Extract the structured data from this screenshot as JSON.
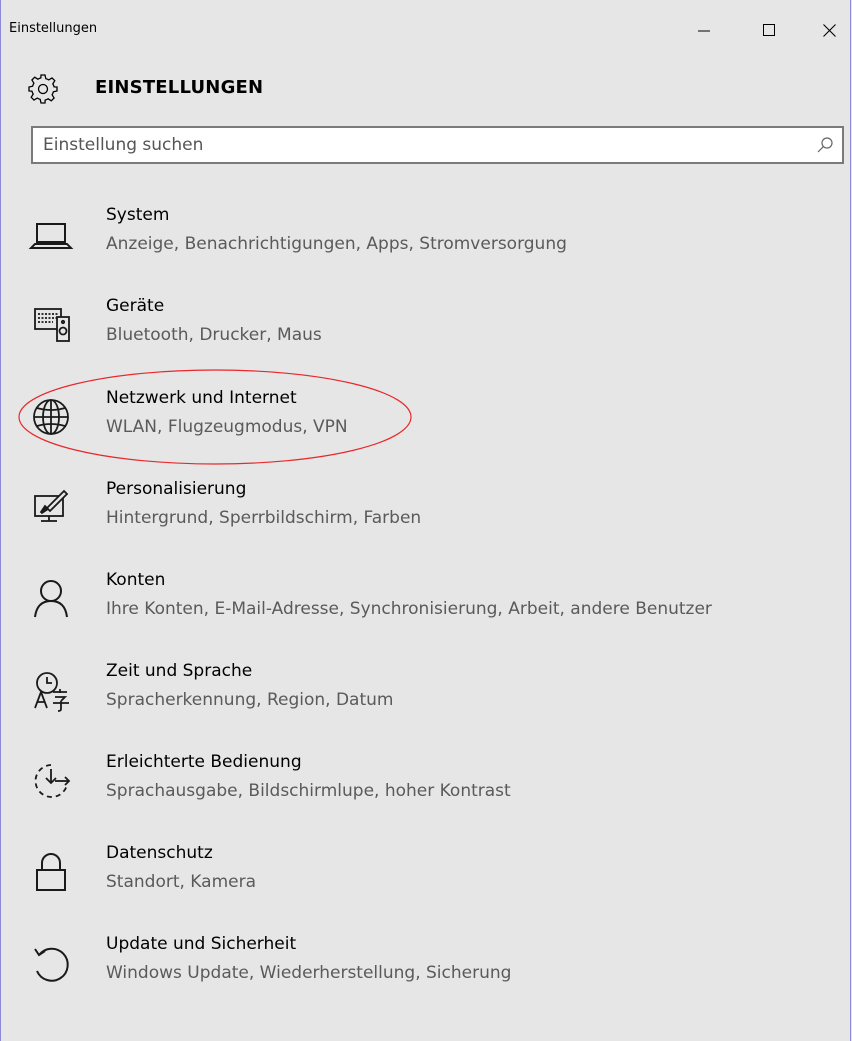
{
  "window": {
    "title": "Einstellungen"
  },
  "header": {
    "title": "EINSTELLUNGEN",
    "icon": "gear-icon"
  },
  "search": {
    "placeholder": "Einstellung suchen",
    "value": "",
    "icon": "search-icon"
  },
  "colors": {
    "background": "#e6e6e6",
    "subtitle": "#5a5a5a",
    "highlight_ellipse": "#e8282b",
    "window_border": "#8a8ad6"
  },
  "items": [
    {
      "title": "System",
      "subtitle": "Anzeige, Benachrichtigungen, Apps, Stromversorgung",
      "icon": "laptop-icon"
    },
    {
      "title": "Geräte",
      "subtitle": "Bluetooth, Drucker, Maus",
      "icon": "devices-icon"
    },
    {
      "title": "Netzwerk und Internet",
      "subtitle": "WLAN, Flugzeugmodus, VPN",
      "icon": "globe-icon"
    },
    {
      "title": "Personalisierung",
      "subtitle": "Hintergrund, Sperrbildschirm, Farben",
      "icon": "personalization-icon"
    },
    {
      "title": "Konten",
      "subtitle": "Ihre Konten, E-Mail-Adresse, Synchronisierung, Arbeit, andere Benutzer",
      "icon": "person-icon"
    },
    {
      "title": "Zeit und Sprache",
      "subtitle": "Spracherkennung, Region, Datum",
      "icon": "time-language-icon"
    },
    {
      "title": "Erleichterte Bedienung",
      "subtitle": "Sprachausgabe, Bildschirmlupe, hoher Kontrast",
      "icon": "ease-of-access-icon"
    },
    {
      "title": "Datenschutz",
      "subtitle": "Standort, Kamera",
      "icon": "lock-icon"
    },
    {
      "title": "Update und Sicherheit",
      "subtitle": "Windows Update, Wiederherstellung, Sicherung",
      "icon": "update-icon"
    }
  ]
}
